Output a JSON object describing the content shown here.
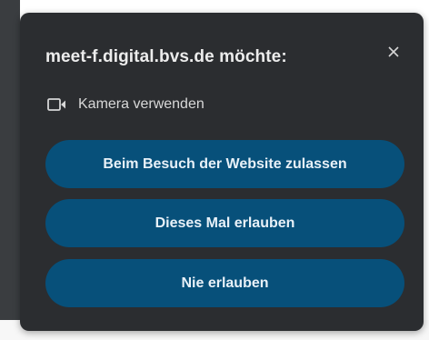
{
  "dialog": {
    "title": "meet-f.digital.bvs.de möchte:",
    "close_icon": "close-icon",
    "permission": {
      "icon": "camera-icon",
      "label": "Kamera verwenden"
    },
    "buttons": [
      {
        "label": "Beim Besuch der Website zulassen"
      },
      {
        "label": "Dieses Mal erlauben"
      },
      {
        "label": "Nie erlauben"
      }
    ]
  },
  "colors": {
    "dialog_bg": "#2b2d30",
    "button_bg": "#07507a",
    "title_text": "#ececec"
  }
}
